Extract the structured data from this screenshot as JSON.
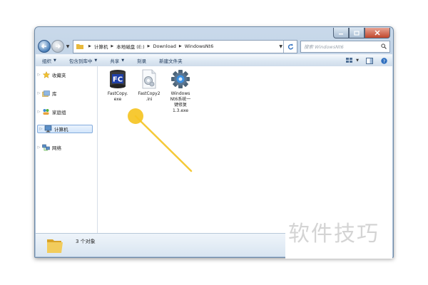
{
  "window": {
    "breadcrumbs": [
      "计算机",
      "本地磁盘 (E:)",
      "Download",
      "WindowsNt6"
    ],
    "search_placeholder": "搜索 WindowsNt6"
  },
  "toolbar": {
    "organize": "组织",
    "include_in_library": "包含到库中",
    "share": "共享",
    "burn": "刻录",
    "new_folder": "新建文件夹"
  },
  "nav_pane": {
    "favorites": "收藏夹",
    "libraries": "库",
    "homegroup": "家庭组",
    "computer": "计算机",
    "network": "网络"
  },
  "files": [
    {
      "name_line1": "FastCopy.",
      "name_line2": "exe",
      "icon": "fastcopy-icon"
    },
    {
      "name_line1": "FastCopy2",
      "name_line2": ".ini",
      "icon": "settings-file-icon"
    },
    {
      "name_line1": "Windows",
      "name_line2": "Nt6系统一",
      "name_line3": "键修复",
      "name_line4": "1.3.exe",
      "icon": "gear-installer-icon"
    }
  ],
  "status": {
    "item_count": "3 个对象"
  },
  "watermark": "软件技巧",
  "colors": {
    "annotation": "#f5c423",
    "selection": "#d3e6fb",
    "toolbar_text": "#1e395b"
  }
}
